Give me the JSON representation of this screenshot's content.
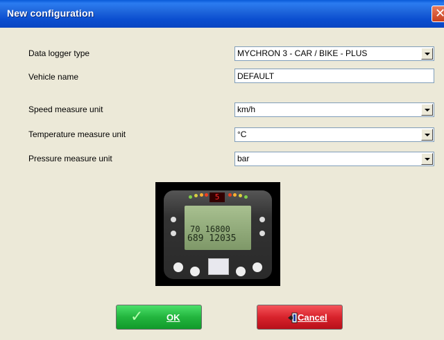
{
  "window": {
    "title": "New configuration",
    "close_glyph": "✕"
  },
  "form": {
    "data_logger_type": {
      "label": "Data logger type",
      "value": "MYCHRON 3 - CAR / BIKE - PLUS"
    },
    "vehicle_name": {
      "label": "Vehicle name",
      "value": "DEFAULT"
    },
    "speed_unit": {
      "label": "Speed measure unit",
      "value": "km/h"
    },
    "temperature_unit": {
      "label": "Temperature measure unit",
      "value": "°C"
    },
    "pressure_unit": {
      "label": "Pressure measure unit",
      "value": "bar"
    }
  },
  "device_image": {
    "gear_display": "5",
    "lcd_line1": "70 16800",
    "lcd_line2": "689 12035"
  },
  "buttons": {
    "ok": {
      "label": "OK",
      "icon": "check-icon"
    },
    "cancel": {
      "label": "Cancel",
      "icon": "exit-door-icon"
    }
  },
  "colors": {
    "titlebar": "#0a4ed0",
    "ok_button": "#23b53e",
    "cancel_button": "#d8232c",
    "dialog_bg": "#ece9d8"
  }
}
